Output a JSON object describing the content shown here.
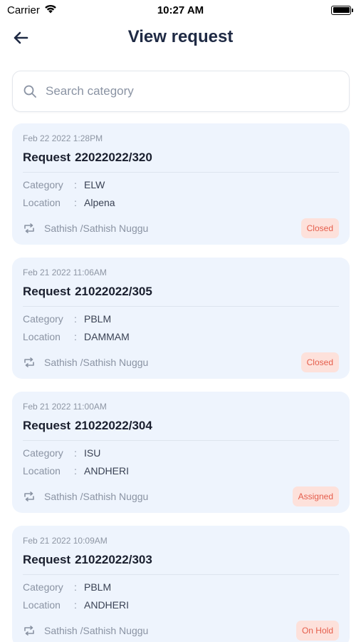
{
  "status_bar": {
    "carrier": "Carrier",
    "time": "10:27 AM"
  },
  "header": {
    "title": "View request"
  },
  "search": {
    "placeholder": "Search category",
    "value": ""
  },
  "labels": {
    "request": "Request",
    "category": "Category",
    "location": "Location",
    "separator": ":"
  },
  "requests": [
    {
      "date": "Feb 22 2022  1:28PM",
      "number": "22022022/320",
      "category": "ELW",
      "location": "Alpena",
      "assignee": "Sathish /Sathish  Nuggu",
      "status": "Closed"
    },
    {
      "date": "Feb 21 2022 11:06AM",
      "number": "21022022/305",
      "category": "PBLM",
      "location": "DAMMAM",
      "assignee": "Sathish /Sathish  Nuggu",
      "status": "Closed"
    },
    {
      "date": "Feb 21 2022 11:00AM",
      "number": "21022022/304",
      "category": "ISU",
      "location": "ANDHERI",
      "assignee": "Sathish /Sathish  Nuggu",
      "status": "Assigned"
    },
    {
      "date": "Feb 21 2022 10:09AM",
      "number": "21022022/303",
      "category": "PBLM",
      "location": "ANDHERI",
      "assignee": "Sathish /Sathish  Nuggu",
      "status": "On Hold"
    }
  ],
  "colors": {
    "card_bg": "#eef4fd",
    "badge_bg": "#fde1db",
    "badge_text": "#e55e4c",
    "title": "#1f2a44"
  },
  "icons": {
    "back": "arrow-left-icon",
    "search": "search-icon",
    "assignee": "reassign-icon",
    "wifi": "wifi-icon",
    "battery": "battery-icon"
  }
}
